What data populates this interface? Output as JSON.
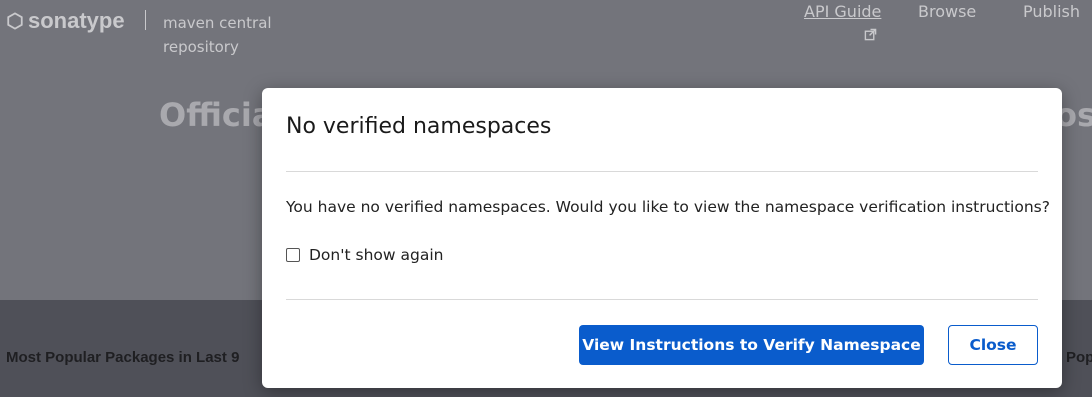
{
  "header": {
    "logo_text": "sonatype",
    "tagline": "maven central repository",
    "nav": {
      "api_guide": "API Guide",
      "browse": "Browse",
      "publish": "Publish"
    }
  },
  "hero": {
    "title_visible_left": "Officia",
    "title_visible_right": "osi"
  },
  "sections": {
    "popular_left": "Most Popular Packages in Last 9",
    "popular_right": "Pop"
  },
  "modal": {
    "title": "No verified namespaces",
    "body": "You have no verified namespaces. Would you like to view the namespace verification instructions?",
    "checkbox_label": "Don't show again",
    "checkbox_checked": false,
    "primary_button": "View Instructions to Verify Namespace",
    "secondary_button": "Close"
  },
  "colors": {
    "accent": "#0a5ccc",
    "hero_background": "#73747b"
  },
  "icons": {
    "logo": "hexagon-icon",
    "external": "external-link-icon"
  }
}
